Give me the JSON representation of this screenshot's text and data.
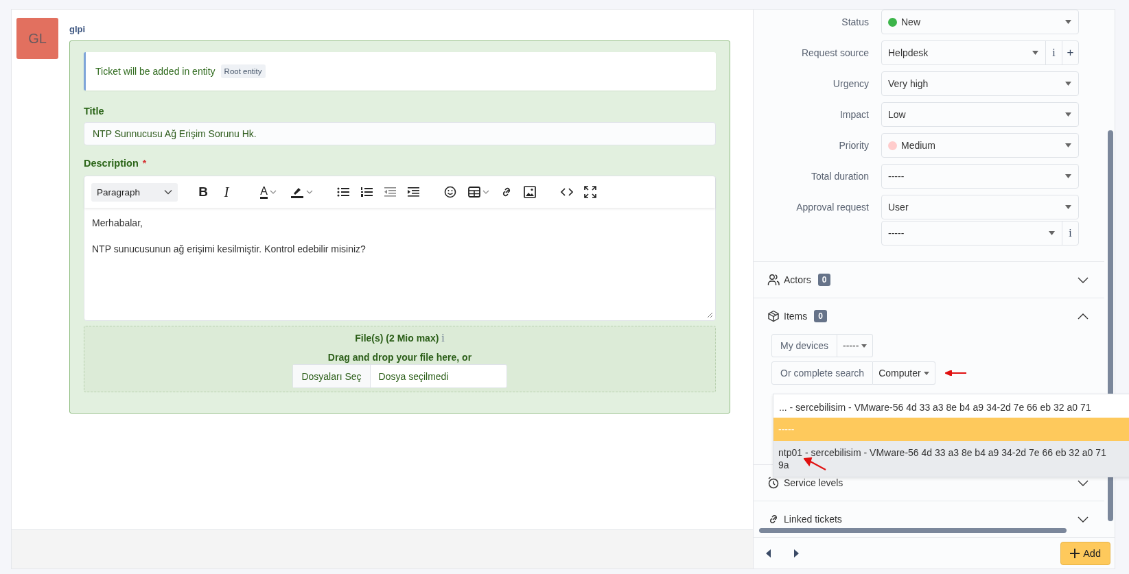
{
  "timeline": {
    "avatar": "GL",
    "author": "glpi",
    "info": {
      "text": "Ticket will be added in entity",
      "entity": "Root entity"
    },
    "title_field": {
      "label": "Title",
      "value": "NTP Sunnucusu Ağ Erişim Sorunu Hk."
    },
    "description": {
      "label": "Description",
      "required_mark": "*",
      "editor": {
        "format": "Paragraph",
        "bold": "B",
        "italic": "I",
        "text_color": "A"
      },
      "lines": [
        "Merhabalar,",
        "NTP sunucusunun ağ erişimi kesilmiştir. Kontrol edebilir misiniz?"
      ]
    },
    "files": {
      "label": "File(s) (2 Mio max)",
      "info": "i",
      "drop_text": "Drag and drop your file here, or",
      "choose_button": "Dosyaları Seç",
      "file_status": "Dosya seçilmedi"
    }
  },
  "fields": [
    {
      "label": "Status",
      "value": "New",
      "color": "#3cb54a"
    },
    {
      "label": "Request source",
      "value": "Helpdesk",
      "addons": [
        "i",
        "+"
      ]
    },
    {
      "label": "Urgency",
      "value": "Very high"
    },
    {
      "label": "Impact",
      "value": "Low"
    },
    {
      "label": "Priority",
      "value": "Medium",
      "color": "#ffcccc"
    },
    {
      "label": "Total duration",
      "value": "-----"
    },
    {
      "label": "Approval request",
      "value": "User"
    },
    {
      "value": "-----",
      "addons": [
        "i"
      ]
    }
  ],
  "sections": [
    {
      "title": "Actors",
      "count": "0",
      "expanded": false
    },
    {
      "title": "Items",
      "count": "0",
      "expanded": true
    },
    {
      "title": "Service levels",
      "expanded": false
    },
    {
      "title": "Linked tickets",
      "expanded": false
    }
  ],
  "items": {
    "my_devices": "My devices",
    "my_devices_value": "-----",
    "search_label": "Or complete search",
    "search_type": "Computer",
    "options": [
      {
        "label": "... - sercebilisim - VMware-56 4d 33 a3 8e b4 a9 34-2d 7e 66 eb 32 a0 71",
        "highlighted": false,
        "selected": false
      },
      {
        "label": "-----",
        "highlighted": true,
        "selected": false
      },
      {
        "label": "ntp01 - sercebilisim - VMware-56 4d 33 a3 8e b4 a9 34-2d 7e 66 eb 32 a0 71 9a",
        "highlighted": false,
        "selected": true
      }
    ]
  },
  "footer": {
    "add_button": "Add"
  }
}
